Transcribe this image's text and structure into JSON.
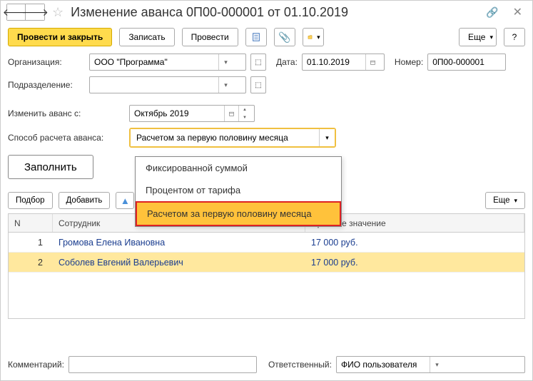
{
  "title": "Изменение аванса 0П00-000001 от 01.10.2019",
  "toolbar": {
    "post_close": "Провести и закрыть",
    "save": "Записать",
    "post": "Провести",
    "more": "Еще",
    "help": "?"
  },
  "fields": {
    "org_label": "Организация:",
    "org_value": "ООО \"Программа\"",
    "date_label": "Дата:",
    "date_value": "01.10.2019",
    "number_label": "Номер:",
    "number_value": "0П00-000001",
    "dept_label": "Подразделение:",
    "dept_value": "",
    "change_from_label": "Изменить аванс с:",
    "change_from_value": "Октябрь 2019",
    "method_label": "Способ расчета аванса:",
    "method_value": "Расчетом за первую половину месяца"
  },
  "dropdown": {
    "options": [
      "Фиксированной суммой",
      "Процентом от тарифа",
      "Расчетом за первую половину месяца"
    ]
  },
  "fill_btn": "Заполнить",
  "subtoolbar": {
    "select": "Подбор",
    "add": "Добавить",
    "more": "Еще"
  },
  "table": {
    "col_n": "N",
    "col_emp": "Сотрудник",
    "col_prev": "Прежнее значение",
    "rows": [
      {
        "n": "1",
        "emp": "Громова Елена Ивановна",
        "prev": "17 000 руб."
      },
      {
        "n": "2",
        "emp": "Соболев Евгений Валерьевич",
        "prev": "17 000 руб."
      }
    ]
  },
  "footer": {
    "comment_label": "Комментарий:",
    "comment_value": "",
    "responsible_label": "Ответственный:",
    "responsible_value": "ФИО пользователя"
  }
}
